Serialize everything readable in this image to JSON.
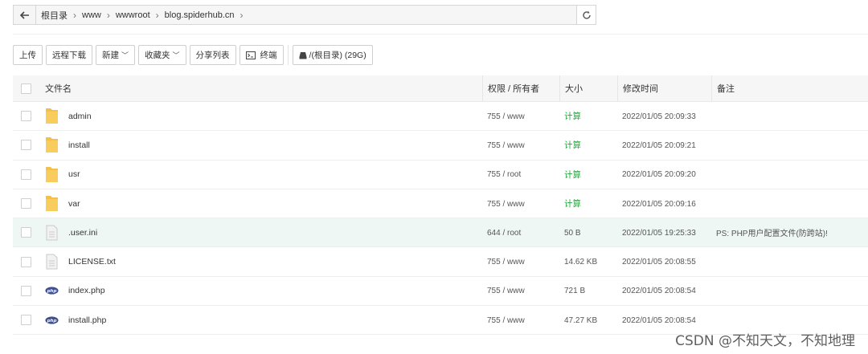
{
  "address_bar": {
    "crumbs": [
      "根目录",
      "www",
      "wwwroot",
      "blog.spiderhub.cn"
    ],
    "back_icon": "arrow-left-icon",
    "refresh_icon": "refresh-icon"
  },
  "toolbar": {
    "upload": "上传",
    "remote_download": "远程下载",
    "new": "新建",
    "favorites": "收藏夹",
    "share_list": "分享列表",
    "terminal": "终端",
    "disk": "/(根目录) (29G)"
  },
  "table": {
    "headers": {
      "name": "文件名",
      "perm": "权限 / 所有者",
      "size": "大小",
      "mtime": "修改时间",
      "note": "备注"
    },
    "rows": [
      {
        "type": "folder",
        "name": "admin",
        "perm": "755 / www",
        "size": "计算",
        "mtime": "2022/01/05 20:09:33",
        "note": ""
      },
      {
        "type": "folder",
        "name": "install",
        "perm": "755 / www",
        "size": "计算",
        "mtime": "2022/01/05 20:09:21",
        "note": ""
      },
      {
        "type": "folder",
        "name": "usr",
        "perm": "755 / root",
        "size": "计算",
        "mtime": "2022/01/05 20:09:20",
        "note": ""
      },
      {
        "type": "folder",
        "name": "var",
        "perm": "755 / www",
        "size": "计算",
        "mtime": "2022/01/05 20:09:16",
        "note": ""
      },
      {
        "type": "file",
        "name": ".user.ini",
        "perm": "644 / root",
        "size": "50 B",
        "mtime": "2022/01/05 19:25:33",
        "note": "PS: PHP用户配置文件(防跨站)!"
      },
      {
        "type": "file",
        "name": "LICENSE.txt",
        "perm": "755 / www",
        "size": "14.62 KB",
        "mtime": "2022/01/05 20:08:55",
        "note": ""
      },
      {
        "type": "php",
        "name": "index.php",
        "perm": "755 / www",
        "size": "721 B",
        "mtime": "2022/01/05 20:08:54",
        "note": ""
      },
      {
        "type": "php",
        "name": "install.php",
        "perm": "755 / www",
        "size": "47.27 KB",
        "mtime": "2022/01/05 20:08:54",
        "note": ""
      }
    ]
  },
  "colors": {
    "calc": "#20a53a",
    "folder": "#f5c04a",
    "php": "#3f4f8f",
    "highlight_row": "#eef7f3"
  },
  "watermark": "CSDN @不知天文，不知地理"
}
